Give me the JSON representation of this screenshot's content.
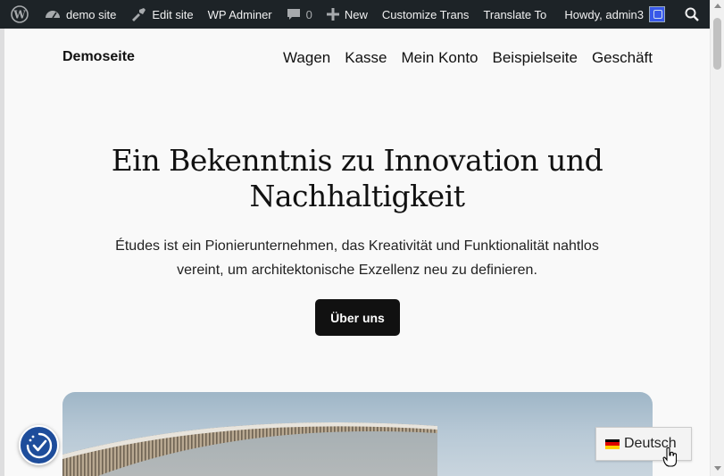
{
  "admin_bar": {
    "site_name": "demo site",
    "edit_site": "Edit site",
    "wp_adminer": "WP Adminer",
    "comments_count": "0",
    "new": "New",
    "customize": "Customize Trans",
    "translate": "Translate To",
    "howdy": "Howdy, admin3"
  },
  "site": {
    "title": "Demoseite",
    "nav": [
      "Wagen",
      "Kasse",
      "Mein Konto",
      "Beispielseite",
      "Geschäft"
    ]
  },
  "hero": {
    "title": "Ein Bekenntnis zu Innovation und Nachhaltigkeit",
    "text": "Études ist ein Pionierunternehmen, das Kreativität und Funktionalität nahtlos vereint, um architektonische Exzellenz neu zu definieren.",
    "button": "Über uns"
  },
  "language_switcher": {
    "label": "Deutsch",
    "flag_colors": [
      "#000000",
      "#dd0000",
      "#ffce00"
    ]
  },
  "colors": {
    "admin_bar": "#1d2327",
    "accessibility_button": "#1e4d9b",
    "button": "#111111"
  }
}
